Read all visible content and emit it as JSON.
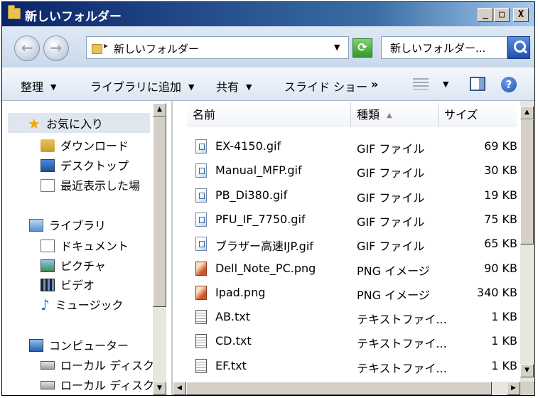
{
  "window": {
    "title": "新しいフォルダー",
    "controls": {
      "minimize": "_",
      "maximize": "□",
      "close": "X"
    }
  },
  "address": {
    "separator": "▸",
    "path": "新しいフォルダー",
    "dropdown": "▼",
    "search_text": "新しいフォルダー..."
  },
  "nav_buttons": {
    "back": "←",
    "forward": "→"
  },
  "toolbar": {
    "organize": "整理",
    "add_to_library": "ライブラリに追加",
    "share": "共有",
    "slideshow": "スライド ショー",
    "more": "»",
    "caret": "▼",
    "help": "?"
  },
  "navigation": {
    "favorites": "お気に入り",
    "downloads": "ダウンロード",
    "desktop": "デスクトップ",
    "recent": "最近表示した場",
    "libraries": "ライブラリ",
    "documents": "ドキュメント",
    "pictures": "ピクチャ",
    "videos": "ビデオ",
    "music": "ミュージック",
    "computer": "コンピューター",
    "local_disk_1": "ローカル ディスク",
    "local_disk_2": "ローカル ディスク"
  },
  "columns": {
    "name": "名前",
    "type": "種類",
    "size": "サイズ",
    "sort_indicator": "▲"
  },
  "files": [
    {
      "name": "EX-4150.gif",
      "type": "GIF ファイル",
      "size": "69 KB",
      "icon": "gif"
    },
    {
      "name": "Manual_MFP.gif",
      "type": "GIF ファイル",
      "size": "30 KB",
      "icon": "gif"
    },
    {
      "name": "PB_Di380.gif",
      "type": "GIF ファイル",
      "size": "19 KB",
      "icon": "gif"
    },
    {
      "name": "PFU_IF_7750.gif",
      "type": "GIF ファイル",
      "size": "75 KB",
      "icon": "gif"
    },
    {
      "name": "ブラザー高速IJP.gif",
      "type": "GIF ファイル",
      "size": "65 KB",
      "icon": "gif"
    },
    {
      "name": "Dell_Note_PC.png",
      "type": "PNG イメージ",
      "size": "90 KB",
      "icon": "png"
    },
    {
      "name": "Ipad.png",
      "type": "PNG イメージ",
      "size": "340 KB",
      "icon": "png"
    },
    {
      "name": "AB.txt",
      "type": "テキストファイ...",
      "size": "1 KB",
      "icon": "txt"
    },
    {
      "name": "CD.txt",
      "type": "テキストファイ...",
      "size": "1 KB",
      "icon": "txt"
    },
    {
      "name": "EF.txt",
      "type": "テキストファイ...",
      "size": "1 KB",
      "icon": "txt"
    }
  ],
  "scroll": {
    "up": "▲",
    "down": "▼",
    "left": "◀",
    "right": "▶"
  }
}
